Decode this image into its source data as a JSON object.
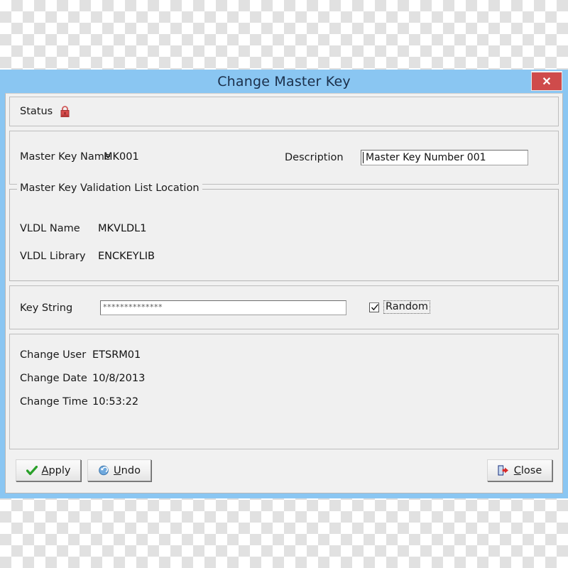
{
  "window": {
    "title": "Change Master Key",
    "close_label": "✕",
    "titlebar_color": "#8ac6f2",
    "close_color": "#cf4b4b"
  },
  "status": {
    "label": "Status",
    "icon": "padlock-icon",
    "icon_color": "#c9302c"
  },
  "master_key": {
    "name_label": "Master Key Name",
    "name_value": "MK001",
    "description_label": "Description",
    "description_value": "Master Key Number 001",
    "description_placeholder": "Description"
  },
  "vldl": {
    "group_title": "Master Key Validation List Location",
    "name_label": "VLDL Name",
    "name_value": "MKVLDL1",
    "library_label": "VLDL Library",
    "library_value": "ENCKEYLIB"
  },
  "key_string": {
    "label": "Key String",
    "value": "**************",
    "placeholder": "Key String",
    "random_label": "Random",
    "random_checked": "✓"
  },
  "change_info": {
    "user_label": "Change User",
    "user_value": "ETSRM01",
    "date_label": "Change Date",
    "date_value": "10/8/2013",
    "time_label": "Change Time",
    "time_value": "10:53:22"
  },
  "buttons": {
    "apply": {
      "pre": "",
      "accel": "A",
      "rest": "pply",
      "icon": "green-check-icon"
    },
    "undo": {
      "pre": "",
      "accel": "U",
      "rest": "ndo",
      "icon": "undo-arrow-icon"
    },
    "close": {
      "pre": "",
      "accel": "C",
      "rest": "lose",
      "icon": "exit-door-icon"
    }
  }
}
